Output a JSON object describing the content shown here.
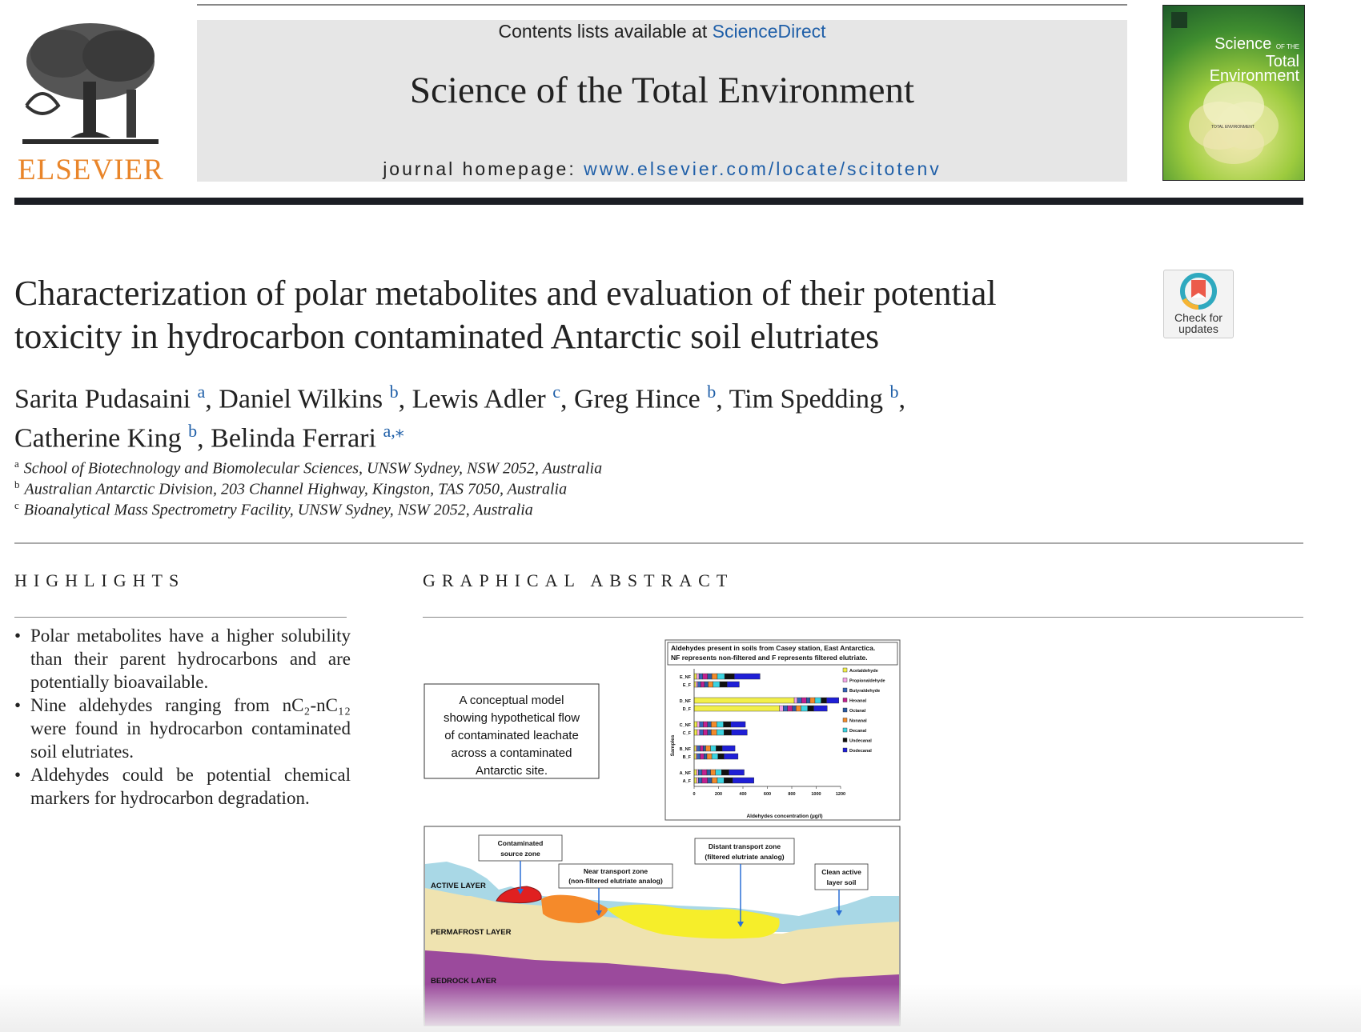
{
  "header": {
    "contents_prefix": "Contents lists available at ",
    "contents_link": "ScienceDirect",
    "journal_title": "Science of the Total Environment",
    "homepage_prefix": "journal homepage: ",
    "homepage_link": "www.elsevier.com/locate/scitotenv",
    "publisher": "ELSEVIER",
    "cover_title_line1": "Science",
    "cover_title_small": "OF THE",
    "cover_title_line2": "Total Environment",
    "cover_center": "TOTAL ENVIRONMENT"
  },
  "check_updates": {
    "line1": "Check for",
    "line2": "updates"
  },
  "article": {
    "title_line1": "Characterization of polar metabolites and evaluation of their potential",
    "title_line2": "toxicity in hydrocarbon contaminated Antarctic soil elutriates",
    "authors": [
      {
        "name": "Sarita Pudasaini",
        "aff": "a",
        "sep": ", "
      },
      {
        "name": "Daniel Wilkins",
        "aff": "b",
        "sep": ", "
      },
      {
        "name": "Lewis Adler",
        "aff": "c",
        "sep": ", "
      },
      {
        "name": "Greg Hince",
        "aff": "b",
        "sep": ", "
      },
      {
        "name": "Tim Spedding",
        "aff": "b",
        "sep": ","
      },
      {
        "name": "Catherine King",
        "aff": "b",
        "sep": ", "
      },
      {
        "name": "Belinda Ferrari",
        "aff": "a,⁎",
        "sep": ""
      }
    ],
    "affiliations": [
      {
        "key": "a",
        "text": "School of Biotechnology and Biomolecular Sciences, UNSW Sydney, NSW 2052, Australia"
      },
      {
        "key": "b",
        "text": "Australian Antarctic Division, 203 Channel Highway, Kingston, TAS 7050, Australia"
      },
      {
        "key": "c",
        "text": "Bioanalytical Mass Spectrometry Facility, UNSW Sydney, NSW 2052, Australia"
      }
    ]
  },
  "highlights": {
    "heading": "HIGHLIGHTS",
    "items": [
      "Polar metabolites have a higher solubility than their parent hydrocarbons and are potentially bioavailable.",
      "Nine aldehydes ranging from nC₂-nC₁₂ were found in hydrocarbon contaminated soil elutriates.",
      "Aldehydes could be potential chemical markers for hydrocarbon degradation."
    ]
  },
  "graphical_abstract": {
    "heading": "GRAPHICAL ABSTRACT",
    "concept_box": [
      "A conceptual model",
      "showing hypothetical flow",
      "of contaminated leachate",
      "across a contaminated",
      "Antarctic site."
    ],
    "layers": [
      "ACTIVE LAYER",
      "PERMAFROST LAYER",
      "BEDROCK LAYER"
    ],
    "zones": [
      {
        "line1": "Contaminated",
        "line2": "source zone"
      },
      {
        "line1": "Near transport zone",
        "line2": "(non-filtered elutriate analog)"
      },
      {
        "line1": "Distant transport zone",
        "line2": "(filtered elutriate analog)"
      },
      {
        "line1": "Clean active",
        "line2": "layer soil"
      }
    ],
    "colors": {
      "active_layer": "#a9d8e6",
      "permafrost": "#efe3b0",
      "bedrock": "#9b4a9c",
      "source": "#e02020",
      "near": "#f58a2a",
      "distant": "#f6ee2a"
    }
  },
  "chart_data": {
    "type": "bar",
    "orientation": "horizontal-stacked",
    "title": "Aldehydes present in soils from Casey station, East Antarctica. NF represents non-filtered and F represents filtered elutriate.",
    "xlabel": "Aldehydes concentration (µg/l)",
    "ylabel": "Samples",
    "xlim": [
      0,
      1200
    ],
    "xticks": [
      "0",
      "200",
      "400",
      "600",
      "800",
      "1000",
      "1200"
    ],
    "categories": [
      "E_NF",
      "E_F",
      "D_NF",
      "D_F",
      "C_NF",
      "C_F",
      "B_NF",
      "B_F",
      "A_NF",
      "A_F"
    ],
    "legend_position": "right",
    "series": [
      {
        "name": "Acetaldehyde",
        "color": "#f2ef4a",
        "values": [
          20,
          15,
          820,
          700,
          25,
          25,
          15,
          15,
          20,
          20
        ]
      },
      {
        "name": "Propionaldehyde",
        "color": "#f7a3e8",
        "values": [
          20,
          15,
          25,
          30,
          20,
          20,
          10,
          10,
          15,
          15
        ]
      },
      {
        "name": "Butyraldehyde",
        "color": "#3563b8",
        "values": [
          30,
          25,
          35,
          35,
          30,
          30,
          25,
          25,
          30,
          30
        ]
      },
      {
        "name": "Hexanal",
        "color": "#c2208f",
        "values": [
          40,
          30,
          40,
          40,
          35,
          35,
          25,
          30,
          40,
          45
        ]
      },
      {
        "name": "Octanal",
        "color": "#2b5aa3",
        "values": [
          35,
          30,
          30,
          30,
          30,
          30,
          20,
          25,
          30,
          35
        ]
      },
      {
        "name": "Nonanal",
        "color": "#f28a2b",
        "values": [
          45,
          40,
          40,
          40,
          45,
          45,
          40,
          40,
          40,
          45
        ]
      },
      {
        "name": "Decanal",
        "color": "#3cd3e0",
        "values": [
          60,
          55,
          50,
          55,
          55,
          60,
          45,
          50,
          50,
          55
        ]
      },
      {
        "name": "Undecanal",
        "color": "#111111",
        "values": [
          80,
          60,
          45,
          50,
          60,
          60,
          50,
          50,
          60,
          70
        ]
      },
      {
        "name": "Dodecanal",
        "color": "#1f1fd6",
        "values": [
          210,
          100,
          100,
          110,
          120,
          130,
          105,
          115,
          125,
          175
        ]
      }
    ]
  }
}
